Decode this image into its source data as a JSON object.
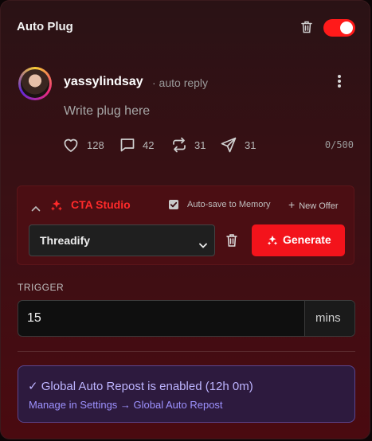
{
  "header": {
    "title": "Auto Plug",
    "toggle_on": true,
    "toggle_color": "#ff1a1a"
  },
  "post": {
    "username": "yassylindsay",
    "reply_tag": "· auto reply",
    "placeholder": "Write plug here",
    "value": "",
    "stats": {
      "likes": "128",
      "comments": "42",
      "reposts": "31",
      "shares": "31"
    },
    "char_count": "0/500"
  },
  "cta_studio": {
    "title": "CTA Studio",
    "title_color": "#ff2a2a",
    "auto_save_label": "Auto-save to Memory",
    "auto_save_checked": true,
    "new_offer_label": "New Offer",
    "selected_offer": "Threadify",
    "generate_label": "Generate",
    "generate_color": "#f3131b"
  },
  "trigger": {
    "label": "TRIGGER",
    "value": "15",
    "unit": "mins"
  },
  "repost": {
    "status": "✓ Global Auto Repost is enabled (12h 0m)",
    "link": "Manage in Settings → Global Auto Repost"
  }
}
